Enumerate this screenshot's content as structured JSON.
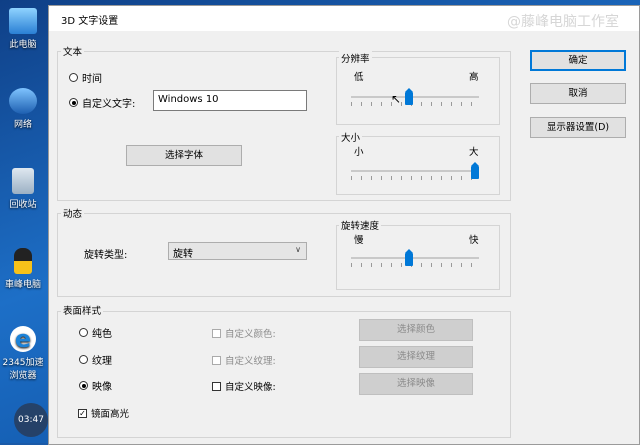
{
  "desktop": {
    "icons": [
      {
        "label": "此电脑",
        "icon": "computer-icon"
      },
      {
        "label": "网络",
        "icon": "network-icon"
      },
      {
        "label": "回收站",
        "icon": "recycle-bin-icon"
      },
      {
        "label": "車峰电脑",
        "icon": "penguin-icon"
      },
      {
        "label": "2345加速浏览器",
        "icon": "browser-icon"
      }
    ],
    "clock": "03:47"
  },
  "window": {
    "title": "3D 文字设置",
    "watermark": "@藤峰电脑工作室"
  },
  "text_group": {
    "label": "文本",
    "time_option": "时间",
    "custom_option": "自定义文字:",
    "custom_value": "Windows 10",
    "select_font_button": "选择字体"
  },
  "resolution": {
    "label": "分辨率",
    "low": "低",
    "high": "高",
    "value_fraction": 0.45
  },
  "size": {
    "label": "大小",
    "small": "小",
    "large": "大",
    "value_fraction": 1.0
  },
  "motion": {
    "label": "动态",
    "rotation_type_label": "旋转类型:",
    "rotation_type_value": "旋转"
  },
  "rotation_speed": {
    "label": "旋转速度",
    "slow": "慢",
    "fast": "快",
    "value_fraction": 0.45
  },
  "surface": {
    "label": "表面样式",
    "solid": "纯色",
    "texture": "纹理",
    "reflection": "映像",
    "specular": "镜面高光",
    "custom_color": "自定义颜色:",
    "custom_texture": "自定义纹理:",
    "custom_reflection": "自定义映像:",
    "pick_color": "选择颜色",
    "pick_texture": "选择纹理",
    "pick_reflection": "选择映像"
  },
  "buttons": {
    "ok": "确定",
    "cancel": "取消",
    "display_settings": "显示器设置(D)"
  },
  "colors": {
    "accent": "#0078d7",
    "dialog_bg": "#f0f0f0"
  }
}
